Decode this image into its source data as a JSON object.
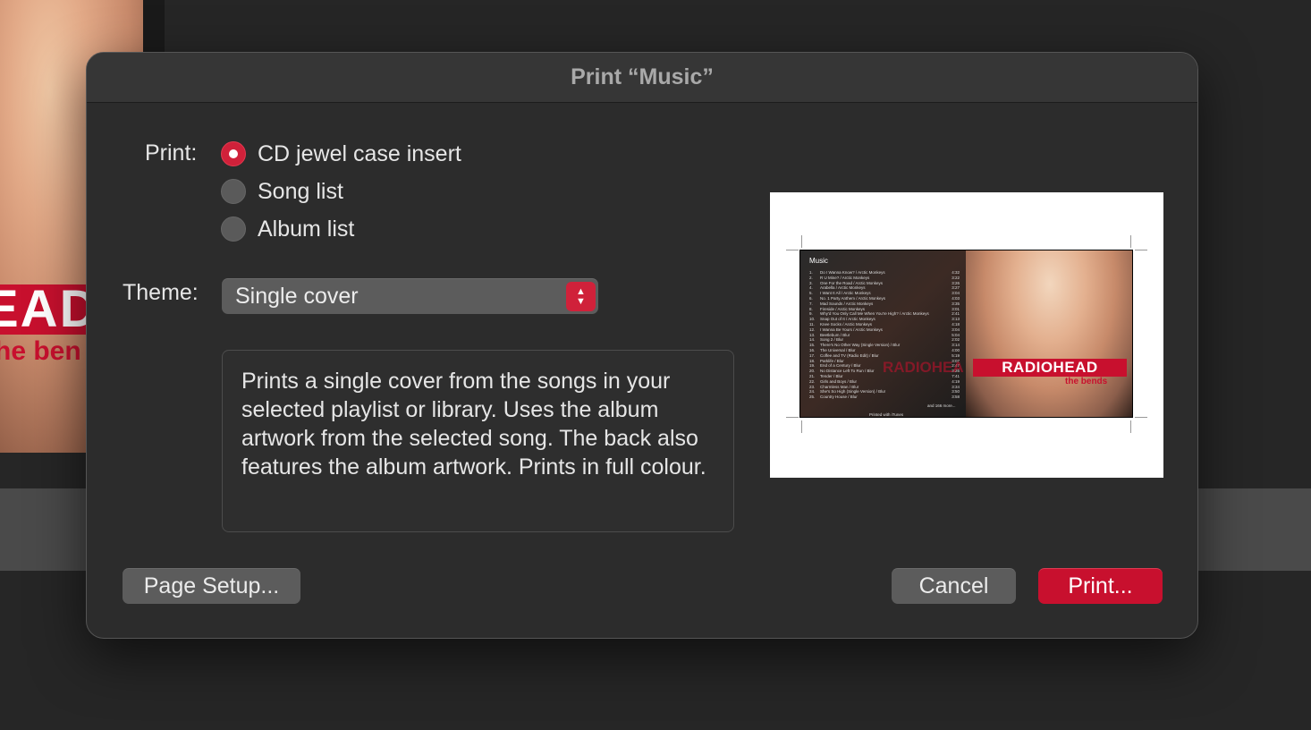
{
  "background": {
    "album_band_text": "EAD",
    "album_sub_text": "he ben"
  },
  "dialog": {
    "title": "Print “Music”",
    "print_label": "Print:",
    "print_options": [
      {
        "label": "CD jewel case insert",
        "selected": true
      },
      {
        "label": "Song list",
        "selected": false
      },
      {
        "label": "Album list",
        "selected": false
      }
    ],
    "theme_label": "Theme:",
    "theme_value": "Single cover",
    "description": "Prints a single cover from the songs in your selected playlist or library. Uses the album artwork from the selected song. The back also features the album artwork. Prints in full colour.",
    "preview": {
      "title": "Music",
      "tracks": [
        {
          "n": "1.",
          "t": "Do I Wanna Know? / Arctic Monkeys",
          "d": "4:32"
        },
        {
          "n": "2.",
          "t": "R U Mine? / Arctic Monkeys",
          "d": "3:22"
        },
        {
          "n": "3.",
          "t": "One For the Road / Arctic Monkeys",
          "d": "3:26"
        },
        {
          "n": "4.",
          "t": "Arabella / Arctic Monkeys",
          "d": "3:27"
        },
        {
          "n": "5.",
          "t": "I Want It All / Arctic Monkeys",
          "d": "3:04"
        },
        {
          "n": "6.",
          "t": "No. 1 Party Anthem / Arctic Monkeys",
          "d": "4:03"
        },
        {
          "n": "7.",
          "t": "Mad Sounds / Arctic Monkeys",
          "d": "3:35"
        },
        {
          "n": "8.",
          "t": "Fireside / Arctic Monkeys",
          "d": "3:01"
        },
        {
          "n": "9.",
          "t": "Why'd You Only Call Me When You're High? / Arctic Monkeys",
          "d": "2:41"
        },
        {
          "n": "10.",
          "t": "Snap Out of It / Arctic Monkeys",
          "d": "3:13"
        },
        {
          "n": "11.",
          "t": "Knee Socks / Arctic Monkeys",
          "d": "4:18"
        },
        {
          "n": "12.",
          "t": "I Wanna Be Yours / Arctic Monkeys",
          "d": "3:04"
        },
        {
          "n": "13.",
          "t": "Beetlebum / Blur",
          "d": "5:04"
        },
        {
          "n": "14.",
          "t": "Song 2 / Blur",
          "d": "2:02"
        },
        {
          "n": "15.",
          "t": "There's No Other Way (Single Version) / Blur",
          "d": "3:14"
        },
        {
          "n": "16.",
          "t": "The Universal / Blur",
          "d": "4:00"
        },
        {
          "n": "17.",
          "t": "Coffee and TV (Radio Edit) / Blur",
          "d": "5:19"
        },
        {
          "n": "18.",
          "t": "Parklife / Blur",
          "d": "3:07"
        },
        {
          "n": "19.",
          "t": "End of a Century / Blur",
          "d": "2:47"
        },
        {
          "n": "20.",
          "t": "No Distance Left To Run / Blur",
          "d": "3:26"
        },
        {
          "n": "21.",
          "t": "Tender / Blur",
          "d": "7:41"
        },
        {
          "n": "22.",
          "t": "Girls and Boys / Blur",
          "d": "4:19"
        },
        {
          "n": "23.",
          "t": "Charmless Man / Blur",
          "d": "3:34"
        },
        {
          "n": "24.",
          "t": "She's So High (Single Version) / Blur",
          "d": "3:50"
        },
        {
          "n": "25.",
          "t": "Country House / Blur",
          "d": "3:58"
        }
      ],
      "more": "and 166 more...",
      "printed_with": "Printed with iTunes",
      "band_name": "RADIOHEAD",
      "album_name": "the bends"
    },
    "buttons": {
      "page_setup": "Page Setup...",
      "cancel": "Cancel",
      "print": "Print..."
    }
  }
}
